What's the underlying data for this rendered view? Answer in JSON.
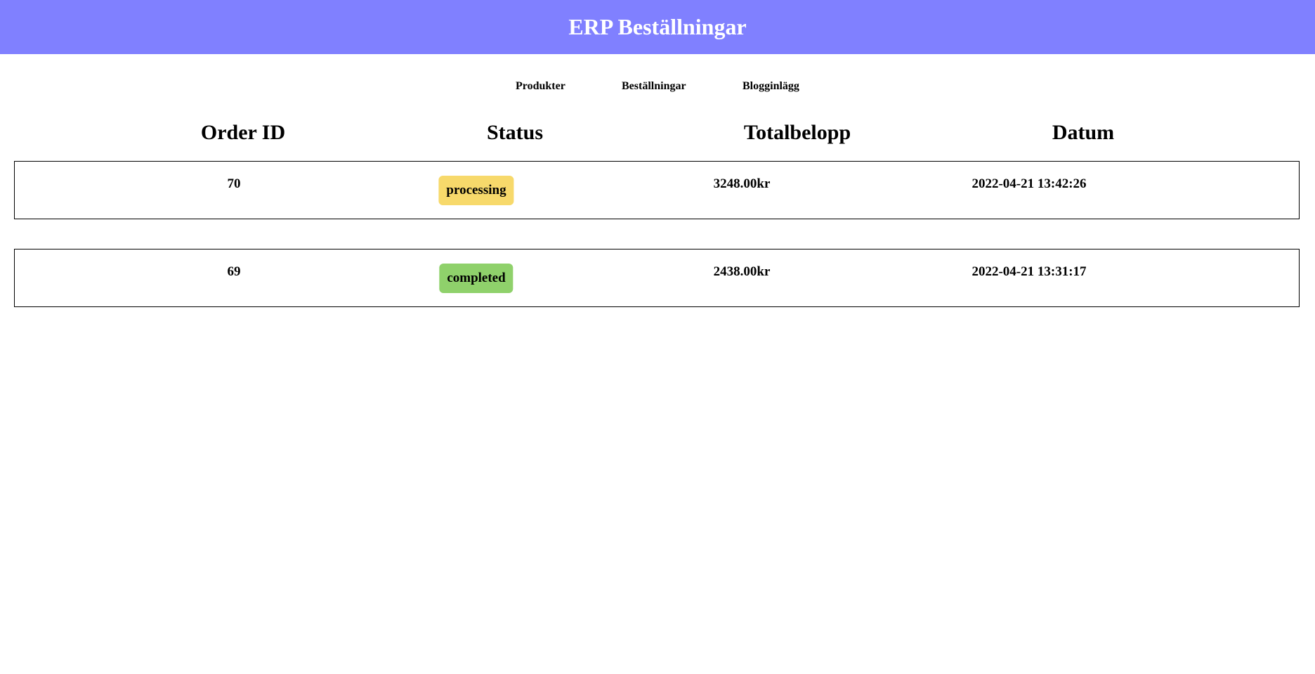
{
  "header": {
    "title": "ERP Beställningar",
    "background_color": "#8080ff"
  },
  "nav": {
    "items": [
      {
        "label": "Produkter"
      },
      {
        "label": "Beställningar"
      },
      {
        "label": "Blogginlägg"
      }
    ]
  },
  "table": {
    "columns": [
      "Order ID",
      "Status",
      "Totalbelopp",
      "Datum"
    ],
    "rows": [
      {
        "order_id": "70",
        "status": "processing",
        "status_color": "#f7d96b",
        "total": "3248.00kr",
        "date": "2022-04-21 13:42:26"
      },
      {
        "order_id": "69",
        "status": "completed",
        "status_color": "#8fd16b",
        "total": "2438.00kr",
        "date": "2022-04-21 13:31:17"
      }
    ]
  }
}
